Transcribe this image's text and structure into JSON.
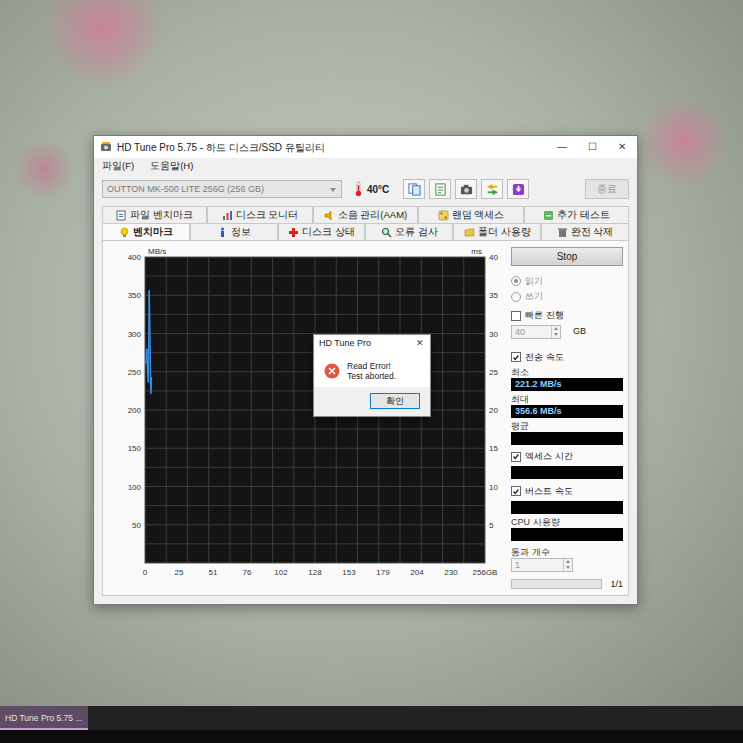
{
  "window": {
    "title": "HD Tune Pro 5.75 - 하드 디스크/SSD 유틸리티",
    "controls": [
      "—",
      "☐",
      "✕"
    ]
  },
  "menu": [
    "파일(F)",
    "도움말(H)"
  ],
  "toolbar": {
    "drive": {
      "label": "OUTTON MK-500 LITE 256G (256 GB)",
      "disabled": true
    },
    "temperature": "40°C",
    "exit": {
      "label": "종료",
      "disabled": true
    }
  },
  "tab_rows": [
    {
      "tabs": [
        {
          "label": "파일 벤치마크",
          "selected": false
        },
        {
          "label": "디스크 모니터",
          "selected": false
        },
        {
          "label": "소음 관리(AAM)",
          "selected": false
        },
        {
          "label": "랜덤 액세스",
          "selected": false
        },
        {
          "label": "추가 테스트",
          "selected": false
        }
      ]
    },
    {
      "tabs": [
        {
          "label": "벤치마크",
          "selected": true
        },
        {
          "label": "정보",
          "selected": false
        },
        {
          "label": "디스크 상태",
          "selected": false
        },
        {
          "label": "오류 검사",
          "selected": false
        },
        {
          "label": "폴더 사용량",
          "selected": false
        },
        {
          "label": "완전 삭제",
          "selected": false
        }
      ]
    }
  ],
  "chart": {
    "y_unit": "MB/s",
    "y_ticks": [
      "400",
      "350",
      "300",
      "250",
      "200",
      "150",
      "100",
      "50"
    ],
    "y2_unit": "ms",
    "y2_ticks": [
      "40",
      "35",
      "30",
      "25",
      "20",
      "15",
      "10",
      "5"
    ],
    "x_ticks": [
      "0",
      "25",
      "51",
      "76",
      "102",
      "128",
      "153",
      "179",
      "204",
      "230",
      "256GB"
    ],
    "series": [
      {
        "name": "transfer rate",
        "values": [
          262,
          280,
          248,
          236,
          356.6,
          298,
          221.2,
          243
        ]
      }
    ]
  },
  "dialog": {
    "title": "HD Tune Pro",
    "close": "✕",
    "message": [
      "Read Error!",
      "Test aborted."
    ],
    "button": "확인"
  },
  "side": {
    "stop": "Stop",
    "modes": [
      {
        "label": "읽기",
        "selected": true,
        "disabled": true
      },
      {
        "label": "쓰기",
        "selected": false,
        "disabled": true
      }
    ],
    "quick": {
      "label": "빠른 진행",
      "checked": false,
      "size": "40",
      "size_disabled": true,
      "unit": "GB"
    },
    "stats": [
      {
        "kind": "checkbox",
        "label": "전송 속도",
        "checked": true
      },
      {
        "kind": "field",
        "label": "최소",
        "value": "221.2 MB/s"
      },
      {
        "kind": "field",
        "label": "최대",
        "value": "356.6 MB/s"
      },
      {
        "kind": "field",
        "label": "평균",
        "value": ""
      },
      {
        "kind": "checkbox",
        "label": "엑세스 시간",
        "checked": true
      },
      {
        "kind": "field",
        "value": ""
      },
      {
        "kind": "checkbox",
        "label": "버스트 속도",
        "checked": true
      },
      {
        "kind": "field",
        "value": ""
      },
      {
        "kind": "field",
        "label": "CPU 사용량",
        "value": ""
      }
    ],
    "passes": {
      "label": "통과 개수",
      "value": "1",
      "disabled": true
    },
    "progress": {
      "level": 0,
      "text": "1/1"
    }
  },
  "taskbar": {
    "items": [
      {
        "label": "HD Tune Pro 5.75 ...",
        "selected": true
      }
    ]
  }
}
